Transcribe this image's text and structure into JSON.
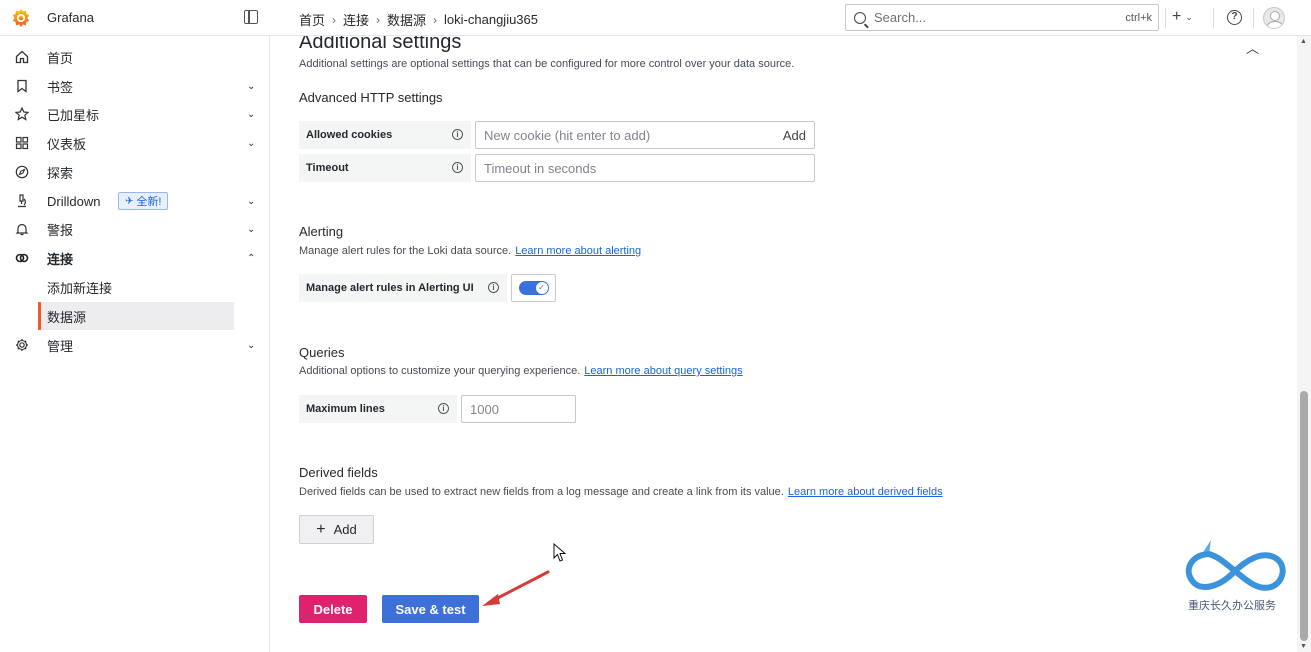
{
  "app": {
    "title": "Grafana"
  },
  "breadcrumb": [
    "首页",
    "连接",
    "数据源",
    "loki-changjiu365"
  ],
  "search": {
    "placeholder": "Search...",
    "shortcut": "ctrl+k"
  },
  "topbar": {
    "plus_label": "+"
  },
  "sidebar": {
    "items": [
      {
        "label": "首页",
        "icon": "home-icon",
        "chevron": ""
      },
      {
        "label": "书签",
        "icon": "bookmark-icon",
        "chevron": "down"
      },
      {
        "label": "已加星标",
        "icon": "star-icon",
        "chevron": "down"
      },
      {
        "label": "仪表板",
        "icon": "dashboard-grid-icon",
        "chevron": "down"
      },
      {
        "label": "探索",
        "icon": "compass-icon",
        "chevron": ""
      },
      {
        "label": "Drilldown",
        "icon": "microscope-icon",
        "chevron": "down",
        "badge": "全新!"
      },
      {
        "label": "警报",
        "icon": "bell-icon",
        "chevron": "down"
      },
      {
        "label": "连接",
        "icon": "link-icon",
        "chevron": "up"
      },
      {
        "label": "添加新连接",
        "sub": true
      },
      {
        "label": "数据源",
        "sub": true,
        "active": true
      },
      {
        "label": "管理",
        "icon": "gear-icon",
        "chevron": "down"
      }
    ]
  },
  "additional": {
    "title": "Additional settings",
    "desc": "Additional settings are optional settings that can be configured for more control over your data source."
  },
  "http": {
    "title": "Advanced HTTP settings",
    "cookies_label": "Allowed cookies",
    "cookies_placeholder": "New cookie (hit enter to add)",
    "cookies_add": "Add",
    "timeout_label": "Timeout",
    "timeout_placeholder": "Timeout in seconds"
  },
  "alerting": {
    "title": "Alerting",
    "desc": "Manage alert rules for the Loki data source.",
    "link": "Learn more about alerting",
    "toggle_label": "Manage alert rules in Alerting UI",
    "toggle_on": true
  },
  "queries": {
    "title": "Queries",
    "desc": "Additional options to customize your querying experience.",
    "link": "Learn more about query settings",
    "max_lines_label": "Maximum lines",
    "max_lines_placeholder": "1000"
  },
  "derived": {
    "title": "Derived fields",
    "desc": "Derived fields can be used to extract new fields from a log message and create a link from its value.",
    "link": "Learn more about derived fields",
    "add_label": "Add"
  },
  "actions": {
    "delete_label": "Delete",
    "save_label": "Save & test"
  },
  "watermark": {
    "text": "重庆长久办公服务"
  },
  "colors": {
    "accent": "#3d71d9",
    "danger": "#e0226e",
    "active_marker": "#f05a28",
    "annotation_arrow": "#d63b3b"
  }
}
